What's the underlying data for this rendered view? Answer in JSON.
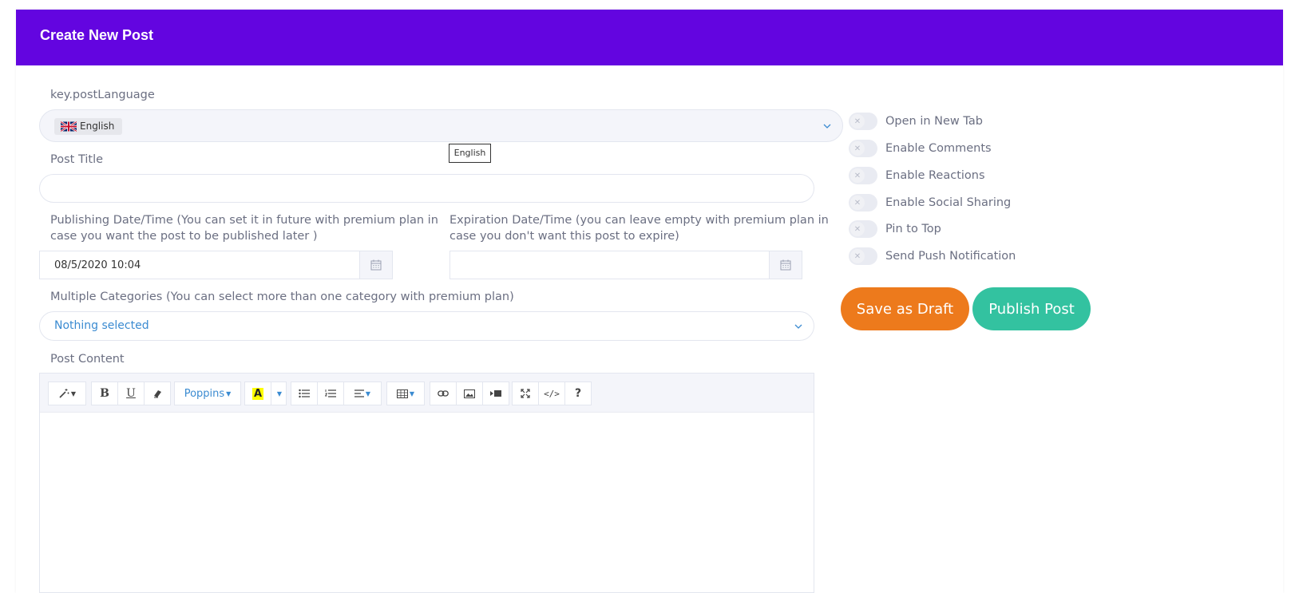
{
  "header": {
    "title": "Create New Post"
  },
  "language": {
    "label": "key.postLanguage",
    "selected": "English",
    "tooltip": "English",
    "flag_icon": "uk-flag-icon"
  },
  "post_title": {
    "label": "Post Title",
    "value": ""
  },
  "publishing": {
    "label_line1": "Publishing Date/Time (You can set it in future with premium plan in",
    "label_line2": "case you want the post to be published later )",
    "value": "08/5/2020 10:04"
  },
  "expiration": {
    "label_line1": "Expiration Date/Time (you can leave empty with premium plan in",
    "label_line2": "case you don't want this post to expire)",
    "value": ""
  },
  "categories": {
    "label": "Multiple Categories (You can select more than one category with premium plan)",
    "selected": "Nothing selected"
  },
  "content": {
    "label": "Post Content",
    "font_name": "Poppins",
    "value": ""
  },
  "toggles": [
    {
      "label": "Open in New Tab",
      "on": false
    },
    {
      "label": "Enable Comments",
      "on": false
    },
    {
      "label": "Enable Reactions",
      "on": false
    },
    {
      "label": "Enable Social Sharing",
      "on": false
    },
    {
      "label": "Pin to Top",
      "on": false
    },
    {
      "label": "Send Push Notification",
      "on": false
    }
  ],
  "actions": {
    "draft": "Save as Draft",
    "publish": "Publish Post"
  },
  "colors": {
    "header": "#6305e0",
    "draft": "#ed7a1c",
    "publish": "#33c2a0",
    "link": "#3b8bd1"
  }
}
